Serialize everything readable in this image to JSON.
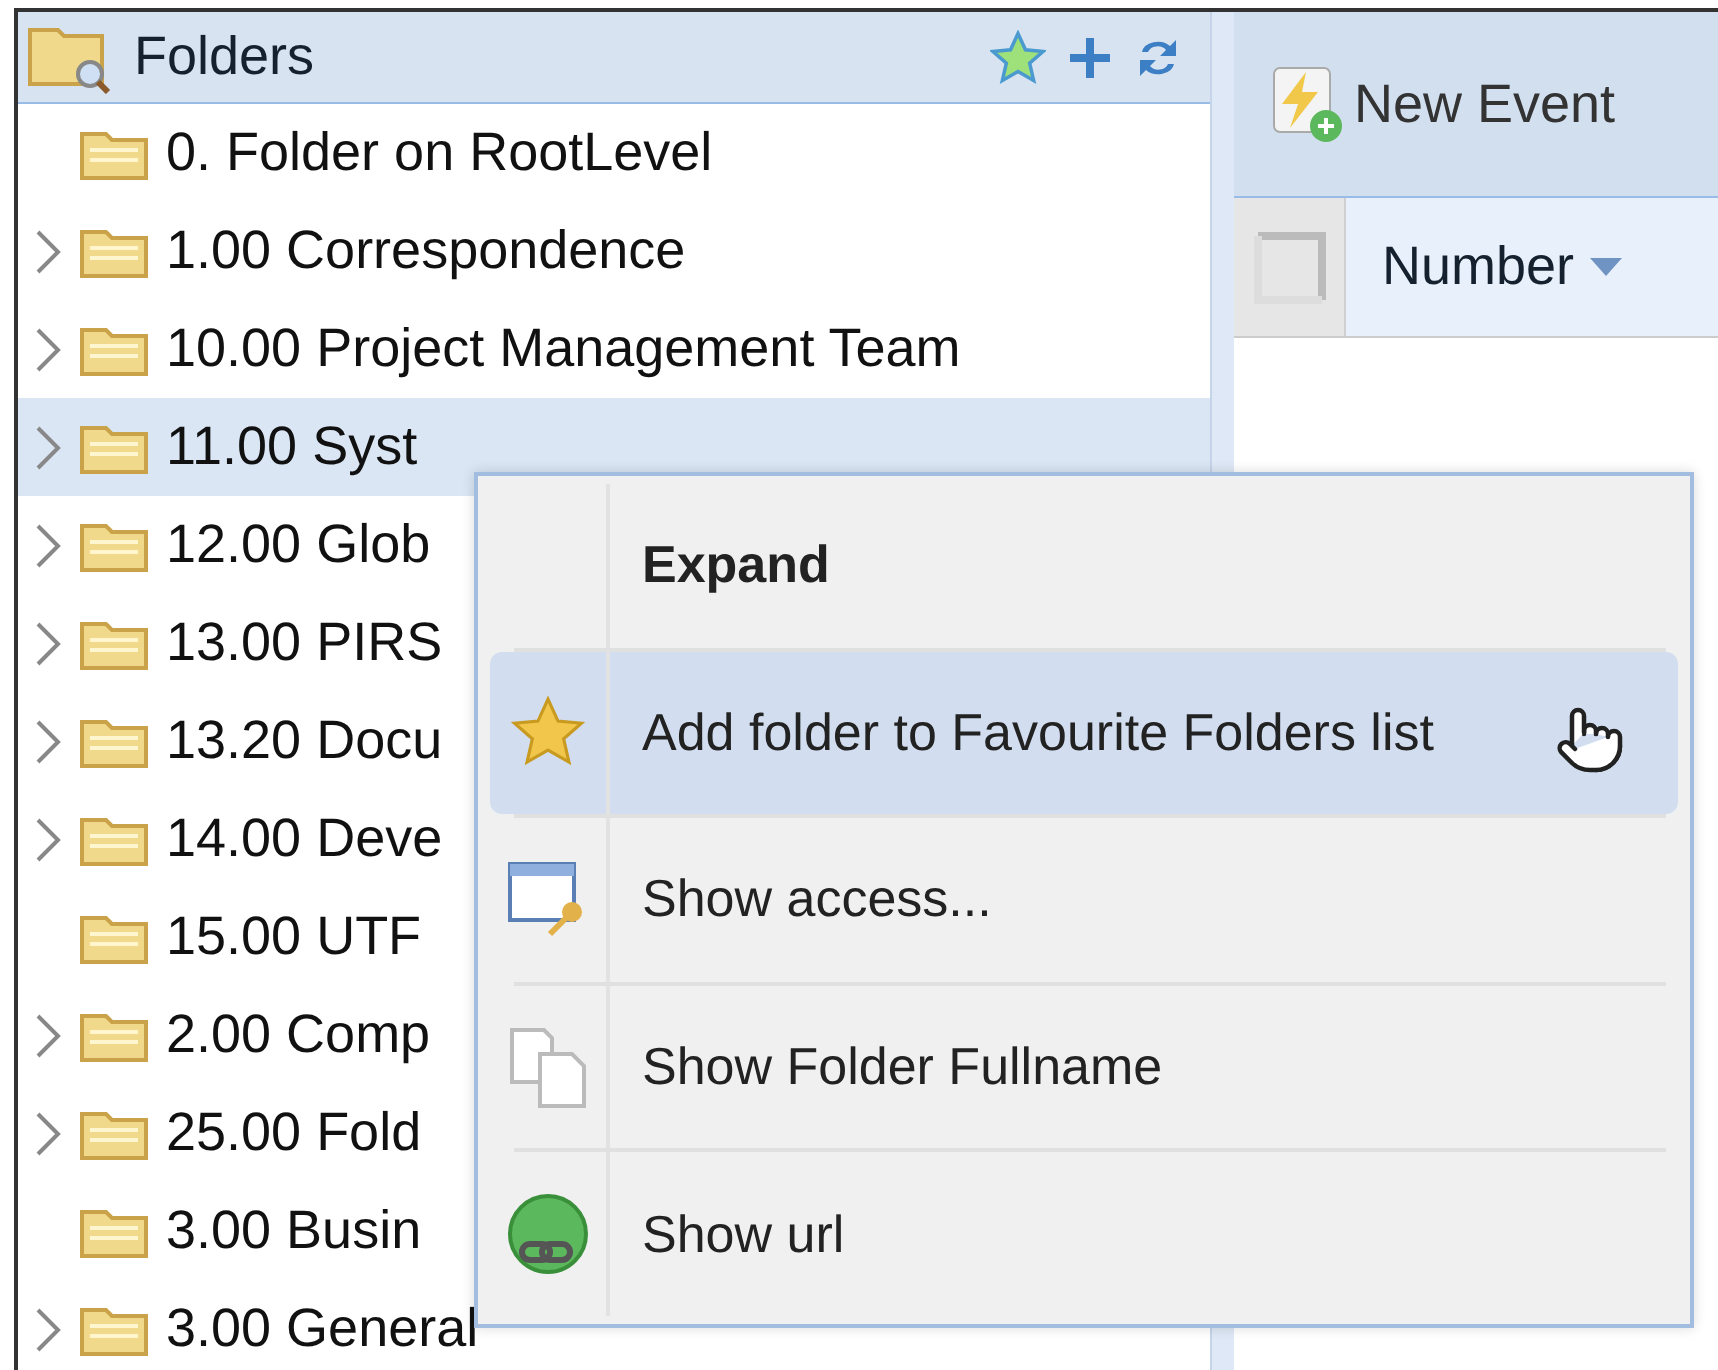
{
  "folders_panel": {
    "title": "Folders",
    "items": [
      {
        "label": "0. Folder on RootLevel",
        "expandable": false,
        "selected": false
      },
      {
        "label": "1.00 Correspondence",
        "expandable": true,
        "selected": false
      },
      {
        "label": "10.00 Project Management Team",
        "expandable": true,
        "selected": false
      },
      {
        "label": "11.00 Syst",
        "expandable": true,
        "selected": true
      },
      {
        "label": "12.00 Glob",
        "expandable": true,
        "selected": false
      },
      {
        "label": "13.00 PIRS",
        "expandable": true,
        "selected": false
      },
      {
        "label": "13.20 Docu",
        "expandable": true,
        "selected": false
      },
      {
        "label": "14.00 Deve",
        "expandable": true,
        "selected": false
      },
      {
        "label": "15.00 UTF",
        "expandable": false,
        "selected": false
      },
      {
        "label": "2.00 Comp",
        "expandable": true,
        "selected": false
      },
      {
        "label": "25.00 Fold",
        "expandable": true,
        "selected": false
      },
      {
        "label": "3.00 Busin",
        "expandable": false,
        "selected": false
      },
      {
        "label": "3.00 General",
        "expandable": true,
        "selected": false
      }
    ]
  },
  "toolbar": {
    "new_event": "New Event"
  },
  "grid": {
    "select_all": {
      "checked": false
    },
    "columns": [
      {
        "label": "Number",
        "sorted": true
      }
    ]
  },
  "context_menu": {
    "items": [
      {
        "label": "Expand",
        "default": true,
        "selected": false
      },
      {
        "label": "Add folder to Favourite Folders list",
        "default": false,
        "selected": true
      },
      {
        "label": "Show access...",
        "default": false,
        "selected": false
      },
      {
        "label": "Show Folder Fullname",
        "default": false,
        "selected": false
      },
      {
        "label": "Show url",
        "default": false,
        "selected": false
      }
    ]
  }
}
